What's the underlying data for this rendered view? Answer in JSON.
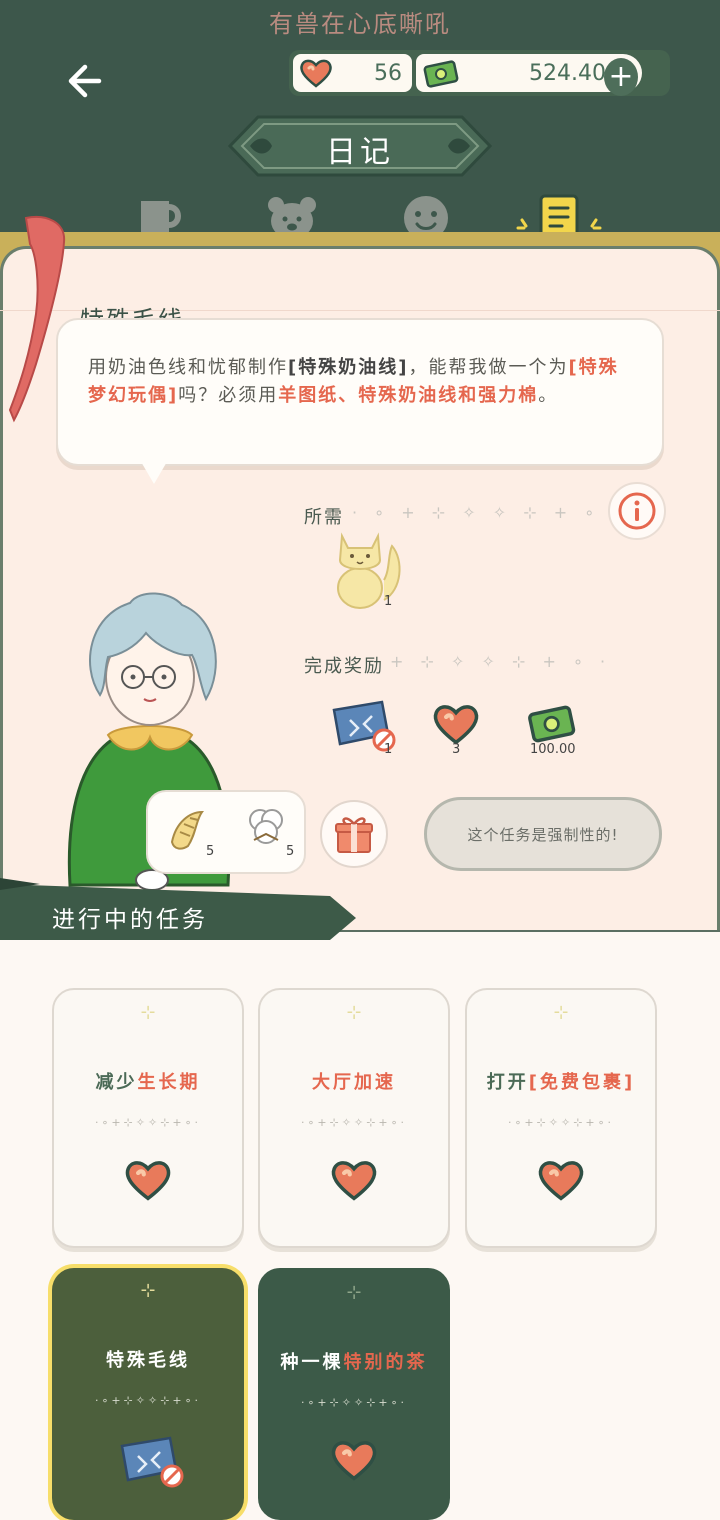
{
  "header": {
    "marquee": "有兽在心底嘶吼",
    "hearts": "56",
    "money": "524.40",
    "plus_label": "+",
    "title": "日记"
  },
  "tabs": [
    {
      "name": "cup-icon"
    },
    {
      "name": "bear-icon"
    },
    {
      "name": "face-icon"
    },
    {
      "name": "diary-icon",
      "selected": true
    }
  ],
  "quest": {
    "name": "特殊毛线",
    "desc_parts": [
      {
        "t": "用奶油色线和忧郁制作",
        "c": "n"
      },
      {
        "t": "[特殊奶油线]",
        "c": "bk"
      },
      {
        "t": "，能帮我做一个为",
        "c": "n"
      },
      {
        "t": "[特殊梦幻玩偶]",
        "c": "hl"
      },
      {
        "t": "吗？必须用",
        "c": "n"
      },
      {
        "t": "羊图纸、特殊奶油线和强力棉",
        "c": "hl"
      },
      {
        "t": "。",
        "c": "n"
      }
    ],
    "needed_label": "所需",
    "needed_count": "1",
    "reward_label": "完成奖励",
    "rewards": [
      {
        "icon": "ticket-icon",
        "count": "1"
      },
      {
        "icon": "heart-icon",
        "count": "3"
      },
      {
        "icon": "money-icon",
        "count": "100.00"
      }
    ],
    "gift_items": [
      {
        "icon": "croissant-icon",
        "count": "5"
      },
      {
        "icon": "cotton-icon",
        "count": "5"
      }
    ],
    "mandatory_text": "这个任务是强制性的!"
  },
  "tasks": {
    "banner": "进行中的任务",
    "cards": [
      {
        "pre": "减少",
        "hl": "生长期",
        "post": "",
        "reward": "heart-icon",
        "style": "light"
      },
      {
        "pre": "",
        "hl": "大厅加速",
        "post": "",
        "reward": "heart-icon",
        "style": "light"
      },
      {
        "pre": "打开",
        "hl": "[免费包裹]",
        "post": "",
        "reward": "heart-icon",
        "style": "light"
      },
      {
        "pre": "特殊毛线",
        "hl": "",
        "post": "",
        "reward": "ticket-icon",
        "style": "selected"
      },
      {
        "pre": "种一棵",
        "hl": "特别的茶",
        "post": "",
        "reward": "heart-icon",
        "style": "dark"
      }
    ],
    "dots": "·∘+⊹✧✧⊹+∘·"
  },
  "colors": {
    "bg": "#3d574b",
    "accent": "#e5674e",
    "panel": "#fdeee5",
    "gold": "#f7de6a"
  }
}
